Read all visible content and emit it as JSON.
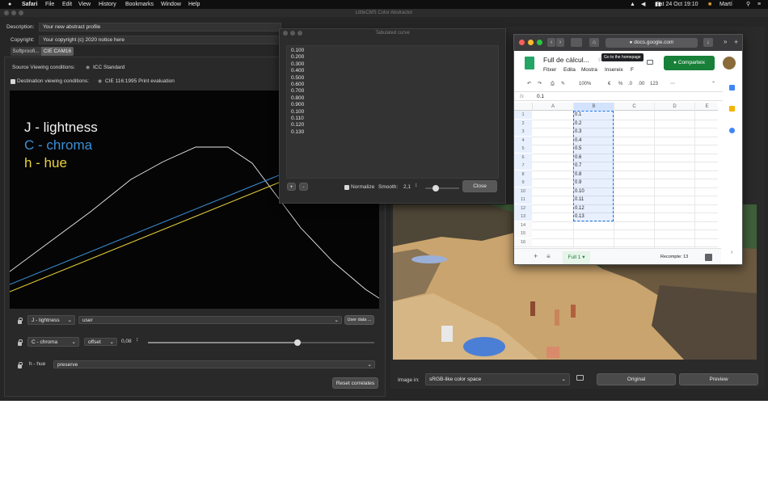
{
  "menubar": {
    "app": "Safari",
    "items": [
      "File",
      "Edit",
      "View",
      "History",
      "Bookmarks",
      "Window",
      "Help"
    ],
    "datetime": "Sat 24 Oct 19:10",
    "user": "Martí"
  },
  "main_window": {
    "title": "LittleCMS Color Abstractor",
    "description_label": "Description:",
    "description_value": "Your new abstract profile",
    "copyright_label": "Copyright:",
    "copyright_value": "Your copyright (c) 2020 notice here",
    "tabs": [
      "Softproofi...",
      "CIE CAM16"
    ],
    "source_label": "Source Viewing conditions:",
    "source_value": "ICC Standard",
    "dest_label": "Destination viewing conditions:",
    "dest_value": "CIE 116:1995  Print evaluation",
    "legend": {
      "j": "J - lightness",
      "c": "C - chroma",
      "h": "h - hue",
      "j_color": "#f2f2f2",
      "c_color": "#3a8fd6",
      "h_color": "#e8d23a"
    },
    "controls": {
      "j_select": "J - lightness",
      "j_mode": "user",
      "user_data_button": "User data ...",
      "c_select": "C - chroma",
      "c_mode": "offset",
      "c_value": "0,08",
      "c_slider_fraction": 0.66,
      "h_label": "h - hue",
      "h_mode": "preserve",
      "reset_button": "Reset correlates"
    },
    "image_in_label": "Image in:",
    "image_in_value": "sRGB-like color space",
    "original_button": "Original",
    "preview_button": "Preview"
  },
  "tabulated": {
    "title": "Tabulated curve",
    "values": [
      "0.100",
      "0.200",
      "0.300",
      "0.400",
      "0.500",
      "0.600",
      "0.700",
      "0.800",
      "0.900",
      "0.100",
      "0.110",
      "0.120",
      "0.130"
    ],
    "plus": "+",
    "minus": "-",
    "normalize_label": "Normalize",
    "smooth_label": "Smooth:",
    "smooth_value": "2,1",
    "smooth_fraction": 0.3,
    "close_button": "Close"
  },
  "browser": {
    "url": "docs.google.com",
    "tooltip": "Go to the homepage",
    "doc_title": "Full de càlcul...",
    "share_button": "Comparteix",
    "menus": [
      "Fitxer",
      "Edita",
      "Mostra",
      "Insereix",
      "F"
    ],
    "zoom": "100%",
    "currency": "€",
    "percent": "%",
    "dec1": ".0",
    "dec2": ".00",
    "numfmt": "123",
    "formula_value": "0.1",
    "columns": [
      "A",
      "B",
      "C",
      "D",
      "E"
    ],
    "row_numbers": [
      "1",
      "2",
      "3",
      "4",
      "5",
      "6",
      "7",
      "8",
      "9",
      "10",
      "11",
      "12",
      "13",
      "14",
      "15",
      "16"
    ],
    "col_b_values": [
      "0.1",
      "0.2",
      "0.3",
      "0.4",
      "0.5",
      "0.6",
      "0.7",
      "0.8",
      "0.9",
      "0.10",
      "0.11",
      "0.12",
      "0.13"
    ],
    "sheet_tab": "Full 1",
    "count_label": "Recompte: 13",
    "accent_color": "#188038"
  }
}
